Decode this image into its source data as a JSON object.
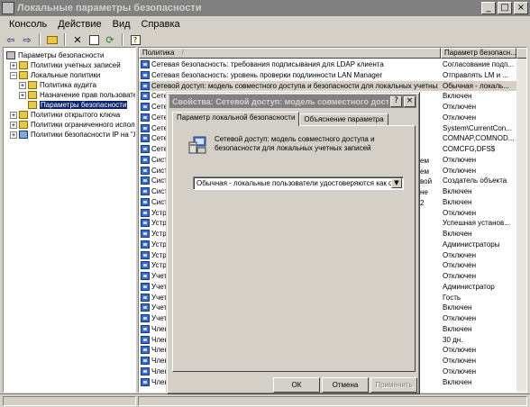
{
  "window": {
    "title": "Локальные параметры безопасности"
  },
  "menu": [
    "Консоль",
    "Действие",
    "Вид",
    "Справка"
  ],
  "toolbar": {
    "icons": [
      "back-icon",
      "forward-icon",
      "up-folder-icon",
      "delete-icon",
      "properties-icon",
      "refresh-icon",
      "help-icon"
    ]
  },
  "tree": {
    "items": [
      {
        "label": "Параметры безопасности"
      },
      {
        "label": "Политики учетных записей"
      },
      {
        "label": "Локальные политики"
      },
      {
        "label": "Политика аудита"
      },
      {
        "label": "Назначение прав пользовате"
      },
      {
        "label": "Параметры безопасности"
      },
      {
        "label": "Политики открытого ключа"
      },
      {
        "label": "Политики ограниченного использ"
      },
      {
        "label": "Политики безопасности IP на \"Лс"
      }
    ]
  },
  "list": {
    "col_policy": "Политика",
    "col_param": "Параметр безопасн...",
    "rows": [
      {
        "policy": "Сетевая безопасность: требования подписывания для LDAP клиента",
        "value": "Согласование подп..."
      },
      {
        "policy": "Сетевая безопасность: уровень проверки подлинности LAN Manager",
        "value": "Отправлять LM и ..."
      },
      {
        "policy": "Сетевой доступ: модель совместного доступа и безопасности для локальных учетных з...",
        "value": "Обычная - локаль..."
      },
      {
        "policy": "Сете",
        "value": "Включен"
      },
      {
        "policy": "Сете",
        "value": "Отключен"
      },
      {
        "policy": "Сете",
        "value": "Отключен"
      },
      {
        "policy": "Сете",
        "value": "System\\CurrentCon..."
      },
      {
        "policy": "Сете",
        "value": "COMNAP,COMNOD..."
      },
      {
        "policy": "Сете",
        "value": "COMCFG,DFS$"
      },
      {
        "policy": "Сист",
        "value": "Отключен"
      },
      {
        "policy": "Сист",
        "value": "Отключен"
      },
      {
        "policy": "Сист",
        "value": "Создатель объекта"
      },
      {
        "policy": "Сист",
        "value": "Включен"
      },
      {
        "policy": "Сист",
        "value": "Включен"
      },
      {
        "policy": "Устр",
        "value": "Отключен"
      },
      {
        "policy": "Устр",
        "value": "Успешная установ..."
      },
      {
        "policy": "Устр",
        "value": "Включен"
      },
      {
        "policy": "Устр",
        "value": "Администраторы"
      },
      {
        "policy": "Устр",
        "value": "Отключен"
      },
      {
        "policy": "Устр",
        "value": "Отключен"
      },
      {
        "policy": "Учет",
        "value": "Отключен"
      },
      {
        "policy": "Учет",
        "value": "Администратор"
      },
      {
        "policy": "Учет",
        "value": "Гость"
      },
      {
        "policy": "Учет",
        "value": "Включен"
      },
      {
        "policy": "Учет",
        "value": "Отключен"
      },
      {
        "policy": "Член",
        "value": "Включен"
      },
      {
        "policy": "Член",
        "value": "30 дн."
      },
      {
        "policy": "Член",
        "value": "Отключен"
      },
      {
        "policy": "Член",
        "value": "Отключен"
      },
      {
        "policy": "Член",
        "value": "Отключен"
      },
      {
        "policy": "Член",
        "value": "Включен"
      }
    ]
  },
  "row_side_text": [
    "ем",
    "ем",
    "вой",
    "не",
    "2"
  ],
  "dialog": {
    "title": "Свойства: Сетевой доступ: модель совместного доступа и безо",
    "tab_local": "Параметр локальной безопасности",
    "tab_explain": "Объяснение параметра",
    "description": "Сетевой доступ: модель совместного доступа и безопасности для локальных учетных записей",
    "selected_option": "Обычная - локальные пользователи удостоверяются как они",
    "ok_label": "ОК",
    "cancel_label": "Отмена",
    "apply_label": "Применить"
  },
  "colors": {
    "selection": "#0a246a",
    "inactive_title": "#808080",
    "face": "#d4d0c8"
  }
}
